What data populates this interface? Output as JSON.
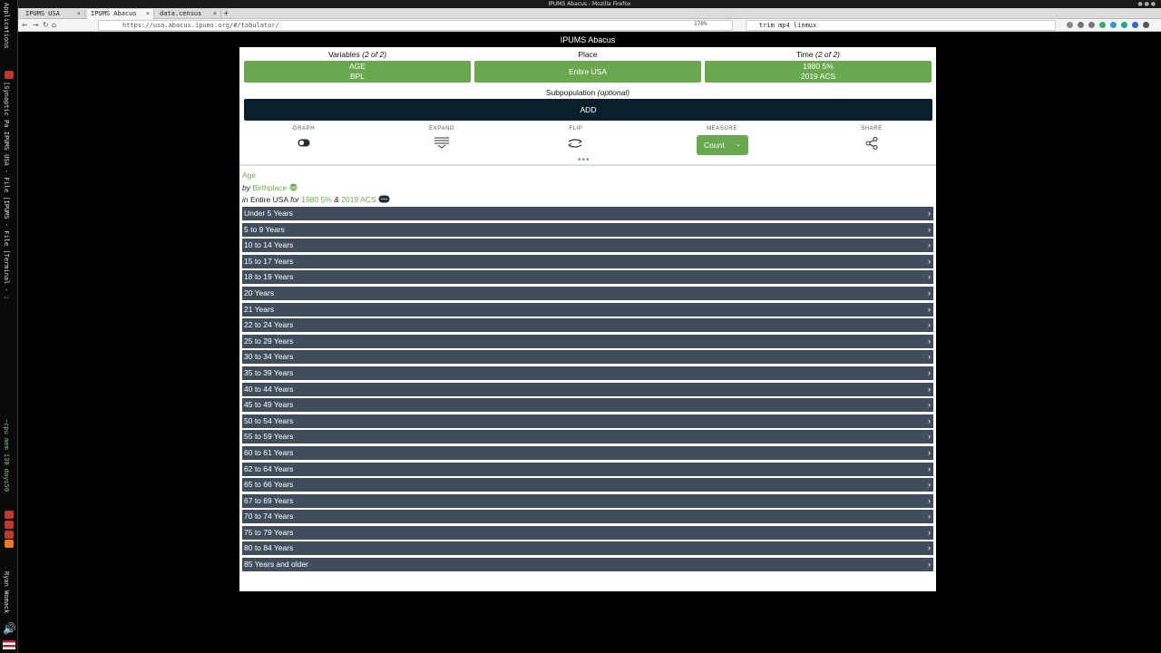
{
  "window": {
    "title": "IPUMS Abacus - Mozilla Firefox",
    "tabs": [
      {
        "label": "IPUMS USA"
      },
      {
        "label": "IPUMS Abacus"
      },
      {
        "label": "data.census"
      }
    ],
    "url": "https://usa.abacus.ipums.org/#/tabulator/",
    "zoom": "170%",
    "search_value": "trim mp4 linmux"
  },
  "wm_panel": {
    "workspaces": "Applications",
    "windows": "[Synaptic Pa IPUMS USA - File [IPUMS - File [Terminal - :",
    "status": "~cpu mem 130 days50",
    "user": "Ryan Womack"
  },
  "page": {
    "header_title": "IPUMS Abacus",
    "variables": {
      "label": "Variables",
      "count": "(2 of 2)",
      "values": [
        "AGE",
        "BPL"
      ]
    },
    "place": {
      "label": "Place",
      "value": "Entire USA"
    },
    "time": {
      "label": "Time",
      "count": "(2 of 2)",
      "values": [
        "1980 5%",
        "2019 ACS"
      ]
    },
    "subpop": {
      "label": "Subpopulation",
      "optional": "(optional)",
      "button": "ADD"
    },
    "tools": {
      "graph": "GRAPH",
      "expand": "EXPAND",
      "flip": "FLIP",
      "measure": "MEASURE",
      "measure_value": "Count",
      "share": "SHARE"
    },
    "description": {
      "variable": "Age",
      "by": "by",
      "by_var": "Birthplace",
      "in": "in",
      "place": "Entire USA",
      "for": "for",
      "time1": "1980 5%",
      "amp": "&",
      "time2": "2019 ACS"
    },
    "rows": [
      "Under 5 Years",
      "5 to 9 Years",
      "10 to 14 Years",
      "15 to 17 Years",
      "18 to 19 Years",
      "20 Years",
      "21 Years",
      "22 to 24 Years",
      "25 to 29 Years",
      "30 to 34 Years",
      "35 to 39 Years",
      "40 to 44 Years",
      "45 to 49 Years",
      "50 to 54 Years",
      "55 to 59 Years",
      "60 to 61 Years",
      "62 to 64 Years",
      "65 to 66 Years",
      "67 to 69 Years",
      "70 to 74 Years",
      "75 to 79 Years",
      "80 to 84 Years",
      "85 Years and older"
    ]
  },
  "colors": {
    "accent_green": "#6aa84f",
    "row_bg": "#3f4d5c",
    "add_bg": "#08202c"
  }
}
